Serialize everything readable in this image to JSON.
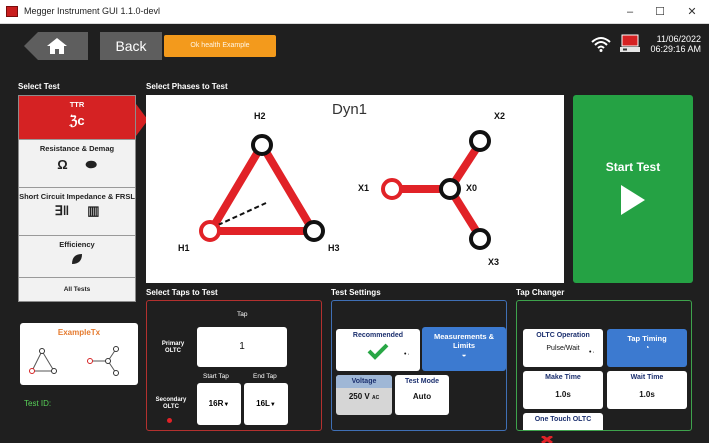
{
  "window": {
    "title": "Megger Instrument GUI 1.1.0-devl",
    "minimize": "–",
    "maximize": "☐",
    "close": "✕"
  },
  "header": {
    "back_label": "Back",
    "breadcrumb": "Ok health Example",
    "date": "11/06/2022",
    "time": "06:29:16 AM"
  },
  "select_test": {
    "label": "Select Test",
    "tiles": [
      {
        "label": "TTR",
        "active": true
      },
      {
        "label": "Resistance & Demag",
        "active": false
      },
      {
        "label": "Short Circuit Impedance & FRSL",
        "active": false
      },
      {
        "label": "Efficiency",
        "active": false
      },
      {
        "label": "All Tests",
        "active": false
      }
    ]
  },
  "example": {
    "title": "ExampleTx"
  },
  "test_id_label": "Test ID:",
  "phases": {
    "label": "Select Phases to Test",
    "vector_group": "Dyn1",
    "nodes": {
      "h1": "H1",
      "h2": "H2",
      "h3": "H3",
      "x0": "X0",
      "x1": "X1",
      "x2": "X2",
      "x3": "X3"
    }
  },
  "start_test": {
    "label": "Start Test"
  },
  "select_taps": {
    "label": "Select Taps to Test",
    "tap_header": "Tap",
    "primary_label": "Primary OLTC",
    "primary_value": "1",
    "secondary_label": "Secondary OLTC",
    "start_tap_label": "Start Tap",
    "end_tap_label": "End Tap",
    "start_tap_value": "16R",
    "end_tap_value": "16L"
  },
  "test_settings": {
    "label": "Test Settings",
    "recommended": "Recommended",
    "measurements_limits": "Measurements & Limits",
    "voltage_label": "Voltage",
    "voltage_value": "250 V",
    "voltage_unit": "AC",
    "test_mode_label": "Test Mode",
    "test_mode_value": "Auto"
  },
  "tap_changer": {
    "label": "Tap Changer",
    "oltc_operation_label": "OLTC Operation",
    "oltc_operation_value": "Pulse/Wait",
    "tap_timing": "Tap Timing",
    "make_time_label": "Make Time",
    "make_time_value": "1.0s",
    "wait_time_label": "Wait Time",
    "wait_time_value": "1.0s",
    "one_touch_label": "One Touch OLTC"
  },
  "colors": {
    "accent_red": "#d52223",
    "start_green": "#25a244",
    "blue_button": "#3c7ad0",
    "breadcrumb_orange": "#f39a1c"
  }
}
